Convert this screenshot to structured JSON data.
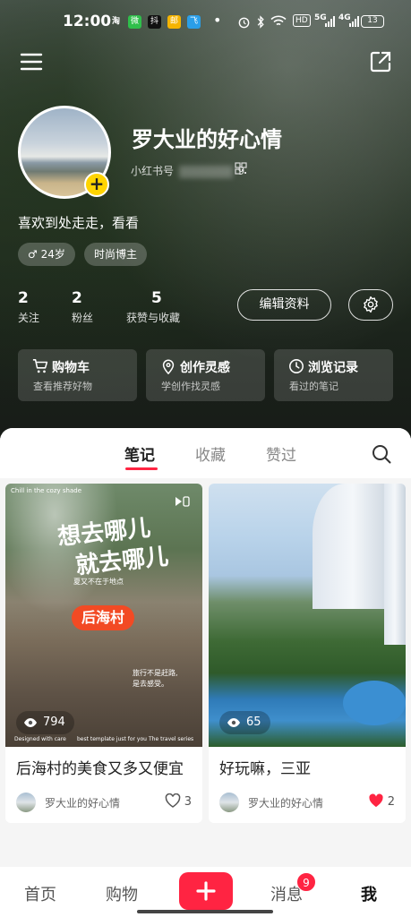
{
  "status_bar": {
    "time": "12:00",
    "apps": [
      "淘",
      "微",
      "抖",
      "邮",
      "飞"
    ],
    "indicators": [
      "alarm-icon",
      "bluetooth-icon",
      "wifi-icon",
      "HD",
      "5G",
      "4G"
    ],
    "hd": "HD",
    "net1": "5G",
    "net2": "4G",
    "battery": "13"
  },
  "profile": {
    "name": "罗大业的好心情",
    "id_label": "小红书号",
    "id_suffix": "9",
    "bio": "喜欢到处走走，看看",
    "tags": [
      "♂ 24岁",
      "时尚博主"
    ],
    "stats": [
      {
        "value": "2",
        "label": "关注"
      },
      {
        "value": "2",
        "label": "粉丝"
      },
      {
        "value": "5",
        "label": "获赞与收藏"
      }
    ],
    "edit_label": "编辑资料"
  },
  "quick_cards": [
    {
      "title": "购物车",
      "subtitle": "查看推荐好物",
      "icon": "cart-icon"
    },
    {
      "title": "创作灵感",
      "subtitle": "学创作找灵感",
      "icon": "location-icon"
    },
    {
      "title": "浏览记录",
      "subtitle": "看过的笔记",
      "icon": "clock-icon"
    }
  ],
  "tabs": [
    {
      "label": "笔记",
      "active": true
    },
    {
      "label": "收藏",
      "active": false
    },
    {
      "label": "赞过",
      "active": false
    }
  ],
  "notes": [
    {
      "title": "后海村的美食又多又便宜",
      "views": "794",
      "author": "罗大业的好心情",
      "likes": "3",
      "liked": false,
      "overlay": {
        "corner": "Chill in the cozy shade",
        "headline1": "想去哪儿",
        "headline2": "就去哪儿",
        "place": "后海村",
        "side1": "夏又不在于地点",
        "side2": "旅行不是赶路,",
        "side3": "是去感受。",
        "foot1": "Designed with care",
        "foot2": "best template just for you",
        "foot3": "The travel series"
      }
    },
    {
      "title": "好玩嘛，三亚",
      "views": "65",
      "author": "罗大业的好心情",
      "likes": "2",
      "liked": true
    }
  ],
  "bottom_nav": {
    "home": "首页",
    "shop": "购物",
    "messages": "消息",
    "messages_badge": "9",
    "me": "我"
  },
  "colors": {
    "accent": "#ff2442",
    "badge_yellow": "#ffd400",
    "place_tag": "#f24a24"
  }
}
